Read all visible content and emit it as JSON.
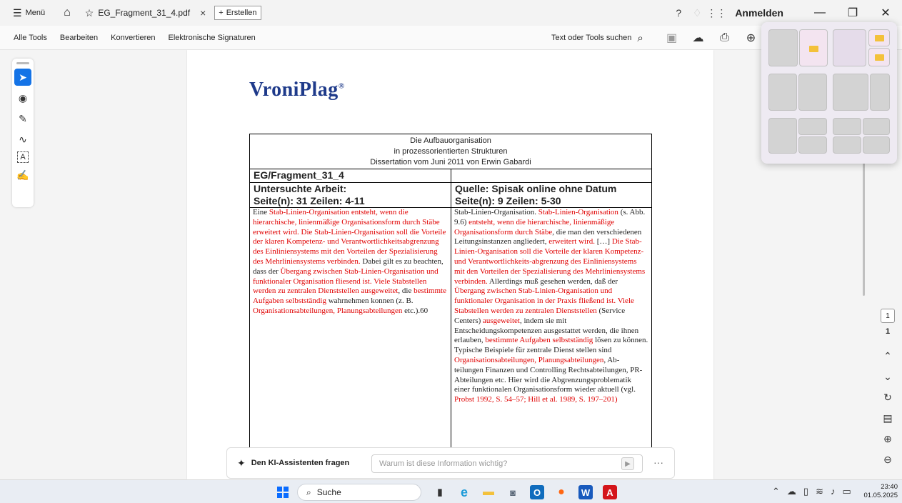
{
  "titlebar": {
    "menu_label": "Menü",
    "tab_title": "EG_Fragment_31_4.pdf",
    "create_label": "Erstellen",
    "signin_label": "Anmelden"
  },
  "toolbar": {
    "menus": [
      "Alle Tools",
      "Bearbeiten",
      "Konvertieren",
      "Elektronische Signaturen"
    ],
    "search_label": "Text oder Tools suchen"
  },
  "document": {
    "logo": "VroniPlag",
    "logo_mark": "®",
    "header_lines": [
      "Die Aufbauorganisation",
      "in prozessorientierten Strukturen",
      "Dissertation vom Juni 2011 von Erwin Gabardi"
    ],
    "fragment_id": "EG/Fragment_31_4",
    "left_head_1": "Untersuchte Arbeit:",
    "left_head_2": "Seite(n): 31 Zeilen: 4-11",
    "right_head_1": "Quelle: Spisak online ohne Datum",
    "right_head_2": "Seite(n): 9 Zeilen: 5-30",
    "left_text": [
      {
        "t": "Eine ",
        "r": false
      },
      {
        "t": "Stab-Linien-Organisation entsteht, wenn die hierarchische, linienmäßige Organisationsform durch Stäbe erweitert wird. Die Stab-Linien-Organisation soll die Vorteile der klaren Kompetenz- und Verantwortlichkeitsabgrenzung des Einliniensystems mit den Vorteilen der Spezialisierung des Mehrliniensystems verbinden.",
        "r": true
      },
      {
        "t": " Dabei gilt es zu beachten, dass der ",
        "r": false
      },
      {
        "t": "Übergang zwischen Stab-Linien-Organisation und funktionaler Organisation fliesend ist. Viele Stabstellen werden zu zentralen Dienststellen ausgeweitet",
        "r": true
      },
      {
        "t": ", die ",
        "r": false
      },
      {
        "t": "bestimmte Aufgaben selbstständig",
        "r": true
      },
      {
        "t": " wahrnehmen konnen (z. B. ",
        "r": false
      },
      {
        "t": "Organisationsabteilungen, Planungsabteilungen",
        "r": true
      },
      {
        "t": " etc.).60",
        "r": false
      }
    ],
    "right_text": [
      {
        "t": "Stab-Linien-Organisation. ",
        "r": false
      },
      {
        "t": "Stab-Linien-Organisation",
        "r": true
      },
      {
        "t": " (s. Abb. 9.6) ",
        "r": false
      },
      {
        "t": "entsteht, wenn die hierarchische, linienmäßige Organisationsform durch Stäbe",
        "r": true
      },
      {
        "t": ", die man den verschiedenen Leitungsinstanzen angliedert, ",
        "r": false
      },
      {
        "t": "erweitert wird.",
        "r": true
      },
      {
        "t": " […] ",
        "r": false
      },
      {
        "t": "Die Stab-Linien-Organisation soll die Vorteile der klaren Kompetenz- und Verantwortlichkeits-abgrenzung des Einliniensystems mit den Vorteilen der Spezialisierung des Mehrliniensystems verbinden.",
        "r": true
      },
      {
        "t": " Allerdings muß gesehen werden, daß der ",
        "r": false
      },
      {
        "t": "Übergang zwischen Stab-Linien-Organisation und funktionaler Organisation in der Praxis fließend ist. Viele Stabstellen werden zu zentralen Dienststellen",
        "r": true
      },
      {
        "t": " (Service Centers) ",
        "r": false
      },
      {
        "t": "ausgeweitet",
        "r": true
      },
      {
        "t": ", indem sie mit Entscheidungskompetenzen ausgestattet werden, die ihnen erlauben, ",
        "r": false
      },
      {
        "t": "bestimmte Aufgaben selbstständig",
        "r": true
      },
      {
        "t": " lösen zu können. Typische Beispiele für zentrale Dienst stellen sind ",
        "r": false
      },
      {
        "t": "Organisationsabteilungen, Planungsabteilungen",
        "r": true
      },
      {
        "t": ", Ab-teilungen Finanzen und Controlling Rechtsabteilungen, PR-Abteilungen etc. Hier wird die Abgrenzungsproblematik einer funktionalen Organisationsform wieder aktuell (vgl. ",
        "r": false
      },
      {
        "t": "Probst 1992, S. 54–57; Hill et al. 1989, S. 197–201)",
        "r": true
      }
    ]
  },
  "pagination": {
    "current_page": "1",
    "total_pages": "1"
  },
  "assistant": {
    "label": "Den KI-Assistenten fragen",
    "placeholder": "Warum ist diese Information wichtig?"
  },
  "taskbar": {
    "search_label": "Suche",
    "time": "23:40",
    "date": "01.05.2025"
  },
  "colors": {
    "accent": "#1473e6",
    "source_highlight": "#e00000",
    "logo": "#1e3a8a"
  }
}
